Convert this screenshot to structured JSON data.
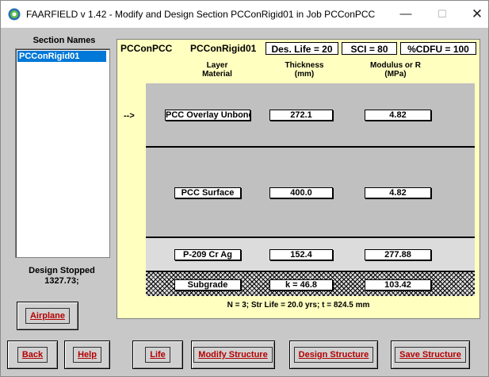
{
  "window": {
    "title": "FAARFIELD v 1.42 - Modify and Design Section PCConRigid01 in Job PCConPCC",
    "minimize": "—",
    "maximize": "☐",
    "close": "✕"
  },
  "sidebar": {
    "title": "Section Names",
    "items": [
      "PCConRigid01"
    ],
    "status_line1": "Design Stopped",
    "status_line2": "1327.73;"
  },
  "header": {
    "job": "PCConPCC",
    "section": "PCConRigid01",
    "des_life": "Des. Life = 20",
    "sci": "SCI = 80",
    "cdfu": "%CDFU = 100"
  },
  "columns": {
    "layer_line1": "Layer",
    "layer_line2": "Material",
    "thick_line1": "Thickness",
    "thick_line2": "(mm)",
    "mod_line1": "Modulus or R",
    "mod_line2": "(MPa)"
  },
  "layers": [
    {
      "material": "PCC Overlay Unbond",
      "thickness": "272.1",
      "modulus": "4.82",
      "arrow": "-->"
    },
    {
      "material": "PCC Surface",
      "thickness": "400.0",
      "modulus": "4.82"
    },
    {
      "material": "P-209 Cr Ag",
      "thickness": "152.4",
      "modulus": "277.88"
    },
    {
      "material": "Subgrade",
      "thickness": "k = 46.8",
      "modulus": "103.42"
    }
  ],
  "summary": "N = 3;  Str Life = 20.0 yrs;  t = 824.5 mm",
  "buttons": {
    "airplane": "Airplane",
    "back": "Back",
    "help": "Help",
    "life": "Life",
    "modify": "Modify Structure",
    "design": "Design Structure",
    "save": "Save Structure"
  }
}
